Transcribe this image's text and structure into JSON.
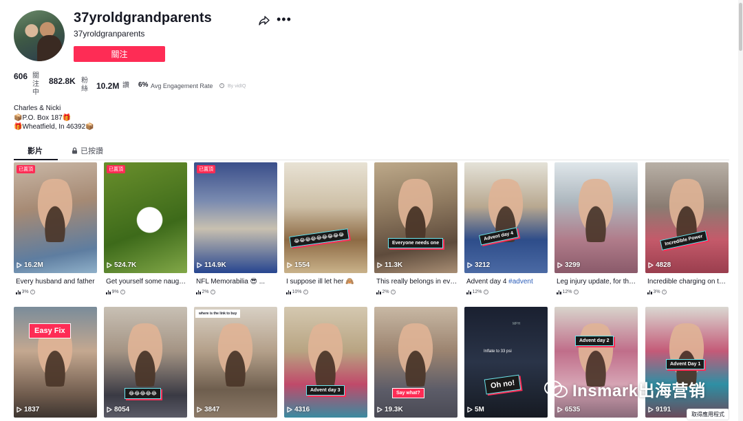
{
  "profile": {
    "username": "37yroldgrandparents",
    "nickname": "37yroldgranparents",
    "follow_label": "關注",
    "share_icon": "share-icon",
    "more_icon": "more-icon"
  },
  "stats": {
    "following": "606",
    "following_label": "關注中",
    "followers": "882.8K",
    "followers_label": "粉絲",
    "likes": "10.2M",
    "likes_label": "讚",
    "engagement": "6%",
    "engagement_label": "Avg Engagement Rate",
    "by": "By vidIQ"
  },
  "bio": {
    "line1": "Charles & Nicki",
    "line2": "📦P.O. Box 187🎁",
    "line3": "🎁Wheatfield, In 46392📦"
  },
  "tabs": {
    "videos": "影片",
    "liked": "已按讚"
  },
  "pinned_label": "已置頂",
  "videos": [
    {
      "views": "16.2M",
      "caption": "Every husband and father",
      "hashtag": "",
      "eng": "3%",
      "pinned": true,
      "overlay": ""
    },
    {
      "views": "524.7K",
      "caption": "Get yourself some naughty",
      "hashtag": "",
      "eng": "9%",
      "pinned": true,
      "overlay": ""
    },
    {
      "views": "114.9K",
      "caption": "NFL Memorabilia 😎 ...",
      "hashtag": "",
      "eng": "2%",
      "pinned": true,
      "overlay": ""
    },
    {
      "views": "1554",
      "caption": "I suppose ill let her 🙈",
      "hashtag": "",
      "eng": "10%",
      "pinned": false,
      "overlay": "😂😂😂😂😂😂😂😂😂"
    },
    {
      "views": "11.3K",
      "caption": "This really belongs in every",
      "hashtag": "",
      "eng": "2%",
      "pinned": false,
      "overlay": "Everyone needs one"
    },
    {
      "views": "3212",
      "caption": "Advent day 4 ",
      "hashtag": "#advent",
      "eng": "12%",
      "pinned": false,
      "overlay": "Advent day 4"
    },
    {
      "views": "3299",
      "caption": "Leg injury update, for those",
      "hashtag": "",
      "eng": "12%",
      "pinned": false,
      "overlay": ""
    },
    {
      "views": "4828",
      "caption": "Incredible charging on the go",
      "hashtag": "",
      "eng": "3%",
      "pinned": false,
      "overlay": "Incredible Power"
    },
    {
      "views": "1837",
      "overlay": "Easy Fix"
    },
    {
      "views": "8054",
      "overlay": "😂😂😂😂😂"
    },
    {
      "views": "3847",
      "overlay": "where is the link to buy"
    },
    {
      "views": "4316",
      "overlay": "Advent day 3"
    },
    {
      "views": "19.3K",
      "overlay": "Say what?"
    },
    {
      "views": "5M",
      "overlay": "Oh no!",
      "extra": [
        "Inflate to 33 psi",
        "MPH"
      ]
    },
    {
      "views": "6535",
      "overlay": "Advent day 2"
    },
    {
      "views": "9191",
      "overlay": "Advent Day 1"
    }
  ],
  "watermark": "Insmark出海营销",
  "get_app": "取得應用程式",
  "colors": {
    "brand": "#fe2c55",
    "accent_cyan": "#6ee8f0",
    "text": "#161823",
    "muted": "#50535c"
  }
}
